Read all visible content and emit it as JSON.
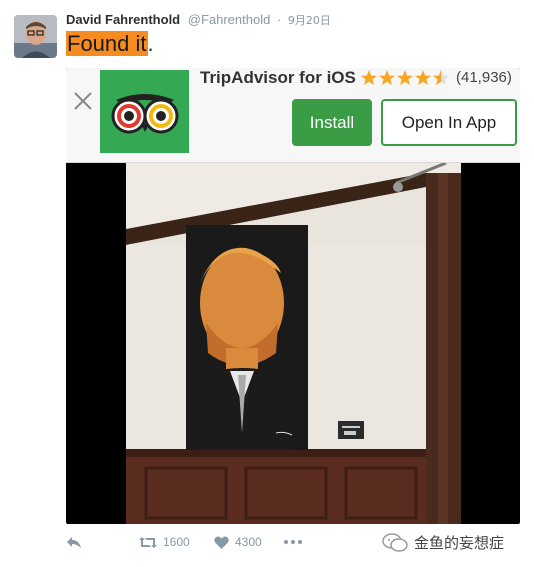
{
  "tweet": {
    "author_name": "David Fahrenthold",
    "handle": "@Fahrenthold",
    "separator": "·",
    "date": "9月20日",
    "text_highlight": "Found it",
    "text_suffix": "."
  },
  "ad_banner": {
    "app_title": "TripAdvisor for iOS",
    "rating_stars": 4.5,
    "review_count": "(41,936)",
    "install_label": "Install",
    "open_label": "Open In App",
    "brand_color": "#34a853",
    "button_color": "#3a9c45"
  },
  "actions": {
    "retweet_count": "1600",
    "like_count": "4300"
  },
  "watermark": {
    "text": "金鱼的妄想症"
  },
  "colors": {
    "highlight": "#f68b1f",
    "meta_text": "#8899a6",
    "star": "#f5a623"
  },
  "icons": [
    "close-icon",
    "owl-logo-icon",
    "star-icon",
    "reply-icon",
    "retweet-icon",
    "like-icon",
    "more-icon",
    "wechat-icon"
  ]
}
